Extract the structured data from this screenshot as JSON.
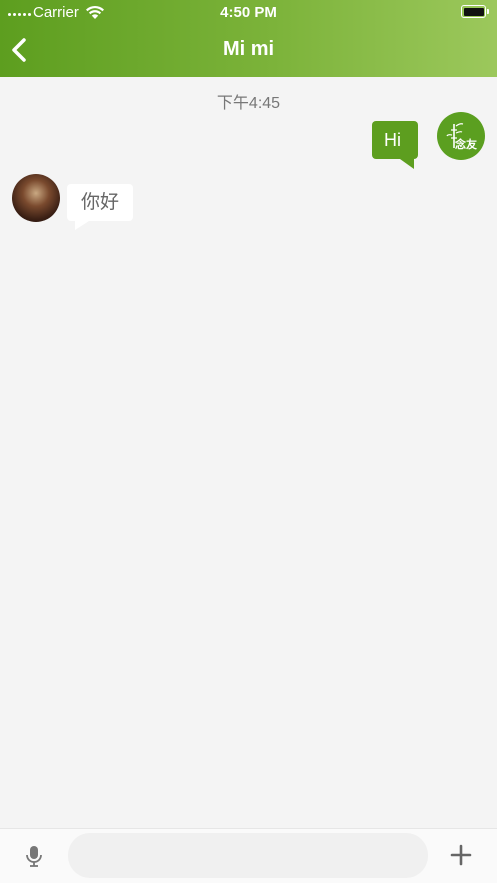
{
  "status_bar": {
    "carrier": "Carrier",
    "time": "4:50 PM"
  },
  "nav": {
    "title": "Mi mi",
    "back_icon": "chevron-left-icon"
  },
  "chat": {
    "timestamp": "下午4:45",
    "messages": [
      {
        "direction": "outgoing",
        "text": "Hi"
      },
      {
        "direction": "incoming",
        "text": "你好"
      }
    ]
  },
  "self_avatar": {
    "logo_text": "念友"
  },
  "input_bar": {
    "placeholder": "",
    "value": "",
    "mic_icon": "microphone-icon",
    "plus_icon": "plus-icon"
  },
  "colors": {
    "brand_green": "#5d9e1f",
    "background": "#f4f4f4"
  }
}
